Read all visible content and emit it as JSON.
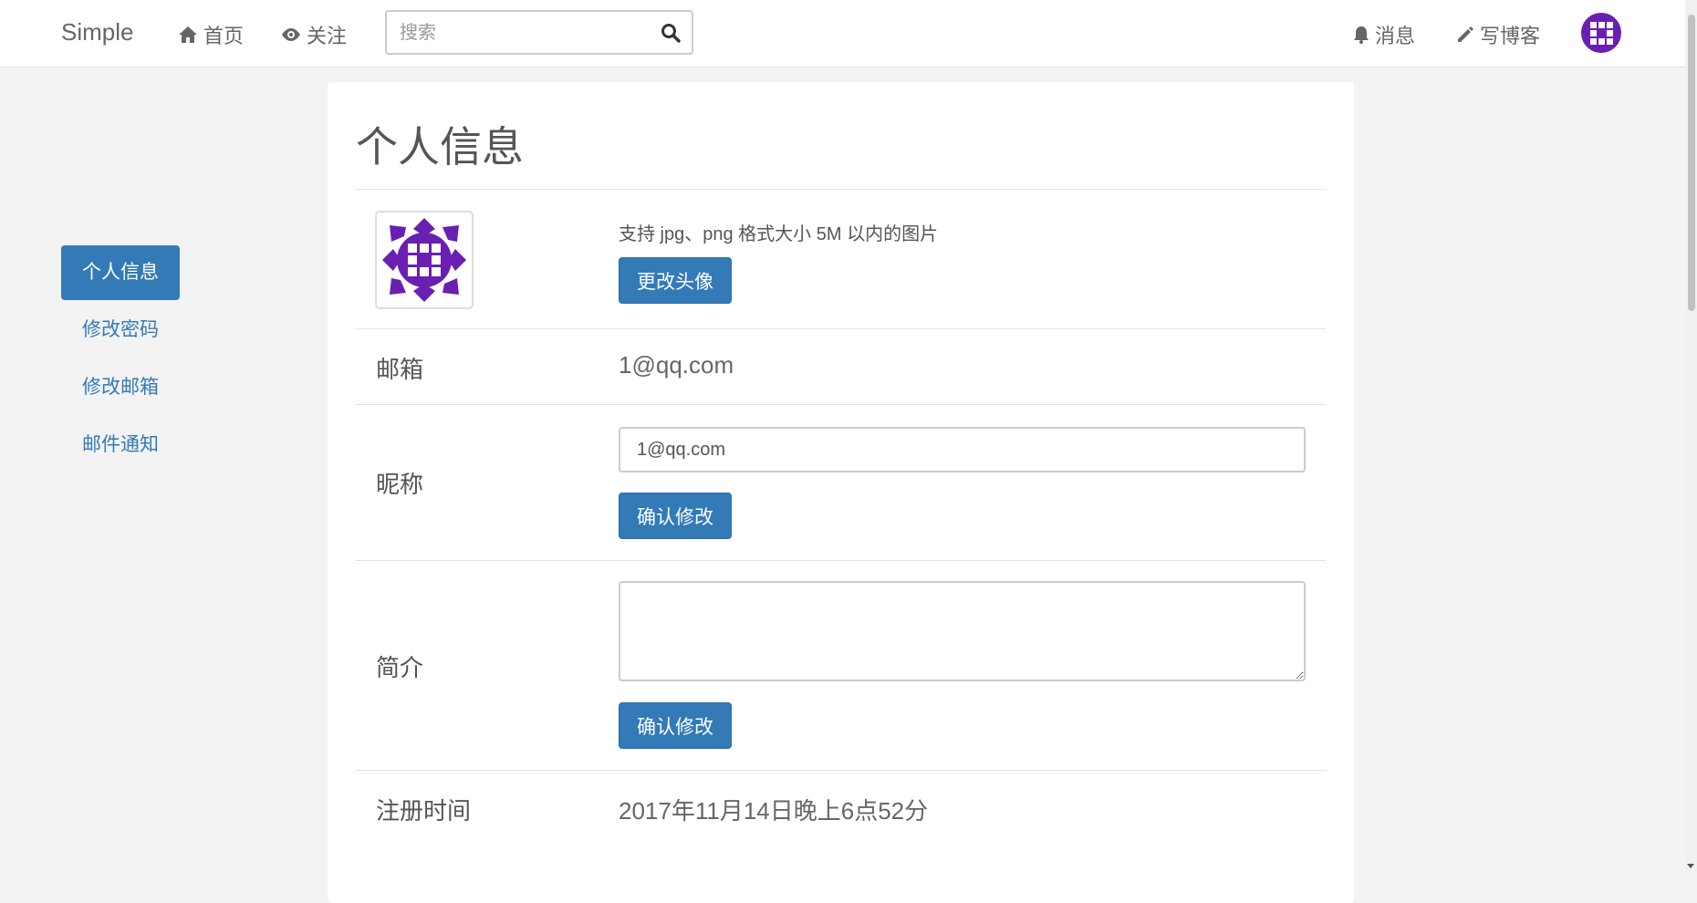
{
  "navbar": {
    "brand": "Simple",
    "home_label": "首页",
    "follow_label": "关注",
    "search_placeholder": "搜索",
    "messages_label": "消息",
    "write_blog_label": "写博客"
  },
  "sidebar": {
    "items": [
      {
        "label": "个人信息",
        "active": true
      },
      {
        "label": "修改密码",
        "active": false
      },
      {
        "label": "修改邮箱",
        "active": false
      },
      {
        "label": "邮件通知",
        "active": false
      }
    ]
  },
  "main": {
    "title": "个人信息",
    "avatar_hint": "支持 jpg、png 格式大小 5M 以内的图片",
    "change_avatar_label": "更改头像",
    "email_label": "邮箱",
    "email_value": "1@qq.com",
    "nickname_label": "昵称",
    "nickname_value": "1@qq.com",
    "nickname_confirm_label": "确认修改",
    "bio_label": "简介",
    "bio_value": "",
    "bio_confirm_label": "确认修改",
    "registered_label": "注册时间",
    "registered_value": "2017年11月14日晚上6点52分"
  },
  "colors": {
    "primary": "#337ab7",
    "avatar_purple": "#6a1fb3",
    "background": "#f3f3f3"
  },
  "icons": {
    "home": "home-icon",
    "follow": "eye-icon",
    "search": "search-icon",
    "messages": "bell-icon",
    "write": "pencil-icon"
  }
}
